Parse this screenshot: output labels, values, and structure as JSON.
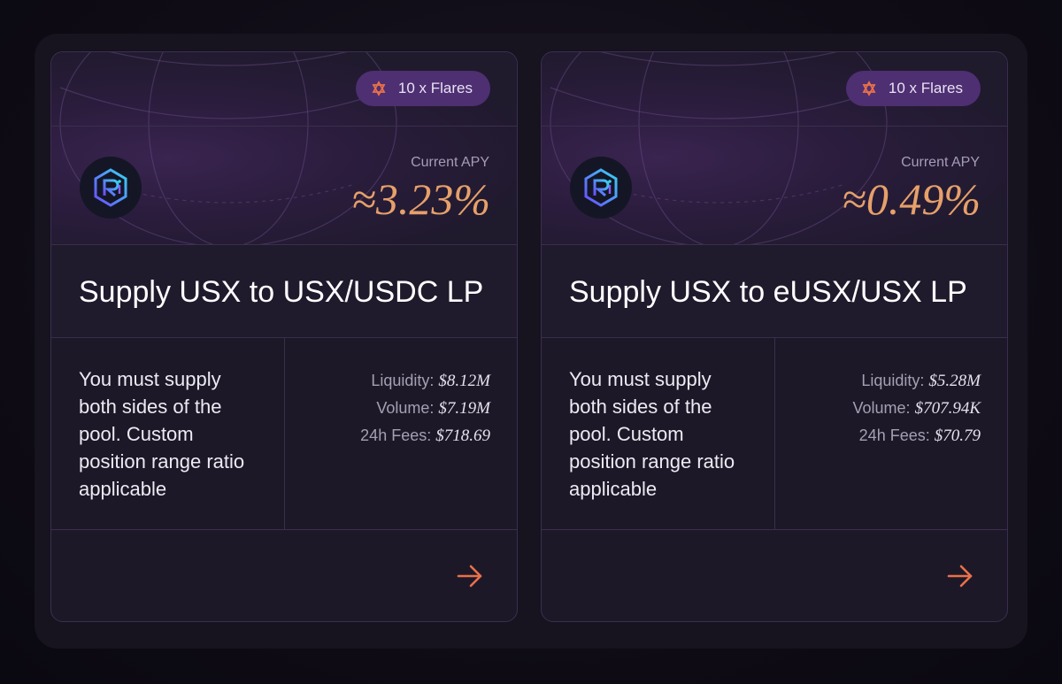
{
  "colors": {
    "accent": "#e6a06a",
    "arrow": "#e9714a",
    "badge_bg": "#4e2f72"
  },
  "cards": [
    {
      "badge_label": "10 x Flares",
      "badge_icon": "flare-icon",
      "logo_icon": "raydium-logo-icon",
      "apy_label": "Current APY",
      "apy_value": "≈3.23%",
      "title": "Supply USX to USX/USDC LP",
      "description": "You must supply both sides of the pool. Custom position range ratio applicable",
      "stats": [
        {
          "label": "Liquidity:",
          "value": "$8.12M"
        },
        {
          "label": "Volume:",
          "value": "$7.19M"
        },
        {
          "label": "24h Fees:",
          "value": "$718.69"
        }
      ],
      "arrow_icon": "arrow-right-icon"
    },
    {
      "badge_label": "10 x Flares",
      "badge_icon": "flare-icon",
      "logo_icon": "raydium-logo-icon",
      "apy_label": "Current APY",
      "apy_value": "≈0.49%",
      "title": "Supply USX to eUSX/USX LP",
      "description": "You must supply both sides of the pool. Custom position range ratio applicable",
      "stats": [
        {
          "label": "Liquidity:",
          "value": "$5.28M"
        },
        {
          "label": "Volume:",
          "value": "$707.94K"
        },
        {
          "label": "24h Fees:",
          "value": "$70.79"
        }
      ],
      "arrow_icon": "arrow-right-icon"
    }
  ]
}
